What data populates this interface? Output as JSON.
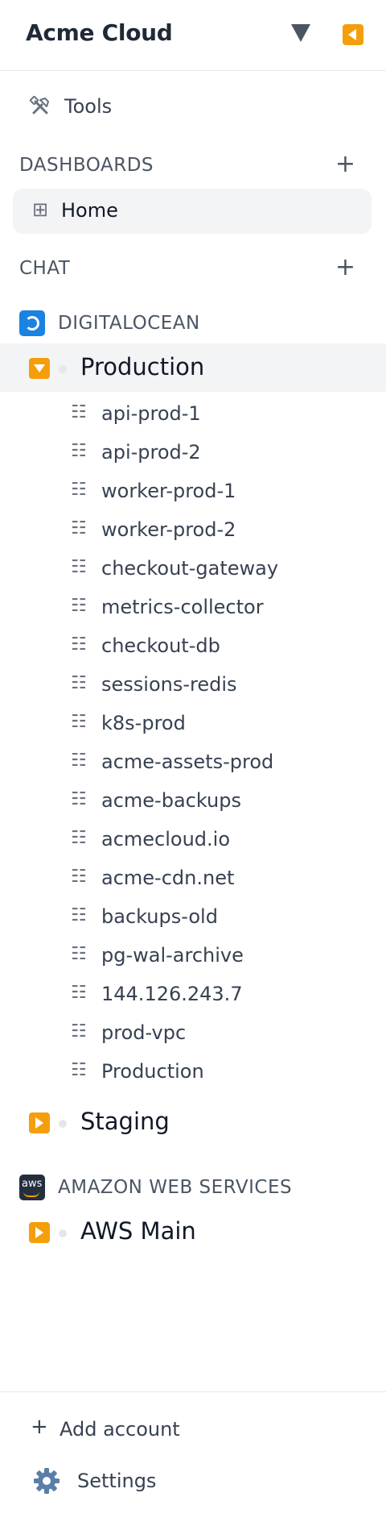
{
  "header": {
    "title": "Acme Cloud"
  },
  "tools": {
    "label": "Tools"
  },
  "dashboards": {
    "heading": "DASHBOARDS",
    "add": "+",
    "home": {
      "icon": "⊞",
      "label": "Home"
    }
  },
  "chat": {
    "heading": "CHAT",
    "add": "+"
  },
  "providers": [
    {
      "name": "DIGITALOCEAN",
      "accounts": [
        {
          "label": "Production",
          "expanded": true,
          "resources": [
            "api-prod-1",
            "api-prod-2",
            "worker-prod-1",
            "worker-prod-2",
            "checkout-gateway",
            "metrics-collector",
            "checkout-db",
            "sessions-redis",
            "k8s-prod",
            "acme-assets-prod",
            "acme-backups",
            "acmecloud.io",
            "acme-cdn.net",
            "backups-old",
            "pg-wal-archive",
            "144.126.243.7",
            "prod-vpc",
            "Production"
          ]
        },
        {
          "label": "Staging",
          "expanded": false
        }
      ]
    },
    {
      "name": "AMAZON WEB SERVICES",
      "logo_text": "aws",
      "accounts": [
        {
          "label": "AWS Main",
          "expanded": false
        }
      ]
    }
  ],
  "resource_icon": "☷",
  "footer": {
    "add_account_icon": "+",
    "add_account": "Add account",
    "settings": "Settings"
  },
  "colors": {
    "accent": "#f59e0b",
    "digitalocean": "#1a82e2",
    "aws_bg": "#232f3e",
    "aws_orange": "#ff9900",
    "active_bg": "#f3f4f6"
  }
}
